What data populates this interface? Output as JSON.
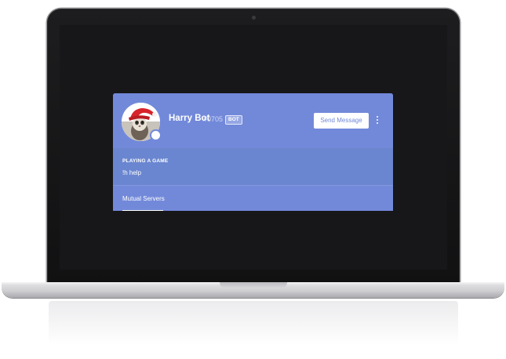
{
  "profile": {
    "username": "Harry Bot",
    "discriminator": "#0705",
    "bot_tag": "BOT",
    "send_message_label": "Send Message",
    "status": "offline"
  },
  "activity": {
    "heading": "PLAYING A GAME",
    "game": "!h help"
  },
  "tabs": {
    "mutual_servers": "Mutual Servers"
  },
  "icons": {
    "more": "more-vertical-icon",
    "avatar": "avatar-image",
    "status": "status-indicator"
  },
  "colors": {
    "blurple": "#7289da",
    "activity_band": "#6a86d0",
    "screen_bg": "#171719",
    "white": "#ffffff"
  }
}
